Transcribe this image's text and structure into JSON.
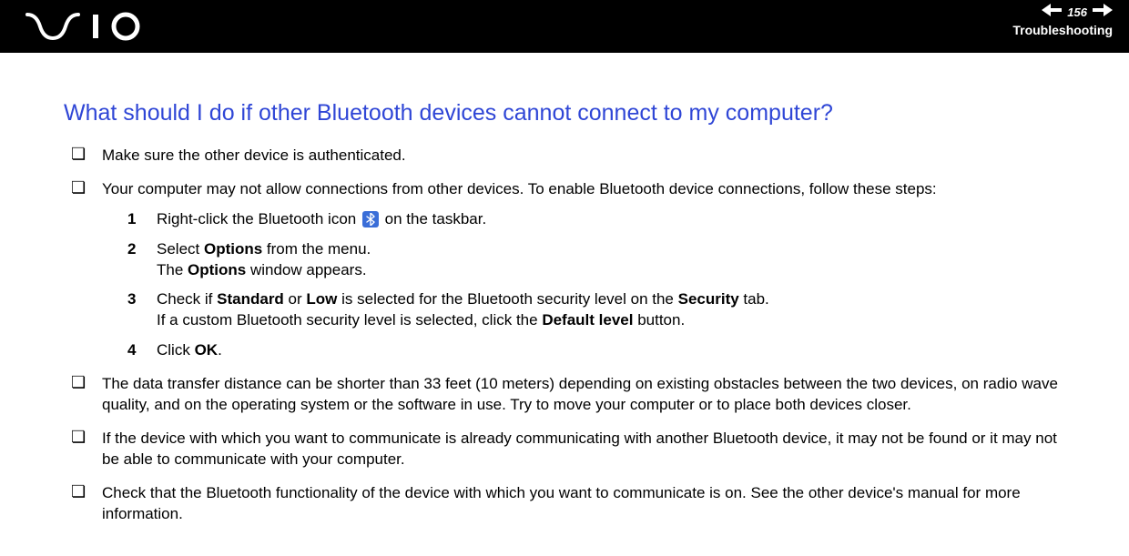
{
  "header": {
    "page_number": "156",
    "section": "Troubleshooting"
  },
  "heading": "What should I do if other Bluetooth devices cannot connect to my computer?",
  "bullets": {
    "b1": "Make sure the other device is authenticated.",
    "b2": "Your computer may not allow connections from other devices. To enable Bluetooth device connections, follow these steps:",
    "b3": "The data transfer distance can be shorter than 33 feet (10 meters) depending on existing obstacles between the two devices, on radio wave quality, and on the operating system or the software in use. Try to move your computer or to place both devices closer.",
    "b4": "If the device with which you want to communicate is already communicating with another Bluetooth device, it may not be found or it may not be able to communicate with your computer.",
    "b5": "Check that the Bluetooth functionality of the device with which you want to communicate is on. See the other device's manual for more information."
  },
  "steps": {
    "s1": {
      "num": "1",
      "pre": "Right-click the Bluetooth icon ",
      "post": " on the taskbar."
    },
    "s2": {
      "num": "2",
      "line1a": "Select ",
      "line1b": "Options",
      "line1c": " from the menu.",
      "line2a": "The ",
      "line2b": "Options",
      "line2c": " window appears."
    },
    "s3": {
      "num": "3",
      "l1a": "Check if ",
      "l1b": "Standard",
      "l1c": " or ",
      "l1d": "Low",
      "l1e": " is selected for the Bluetooth security level on the ",
      "l1f": "Security",
      "l1g": " tab.",
      "l2a": "If a custom Bluetooth security level is selected, click the ",
      "l2b": "Default level",
      "l2c": " button."
    },
    "s4": {
      "num": "4",
      "a": "Click ",
      "b": "OK",
      "c": "."
    }
  }
}
